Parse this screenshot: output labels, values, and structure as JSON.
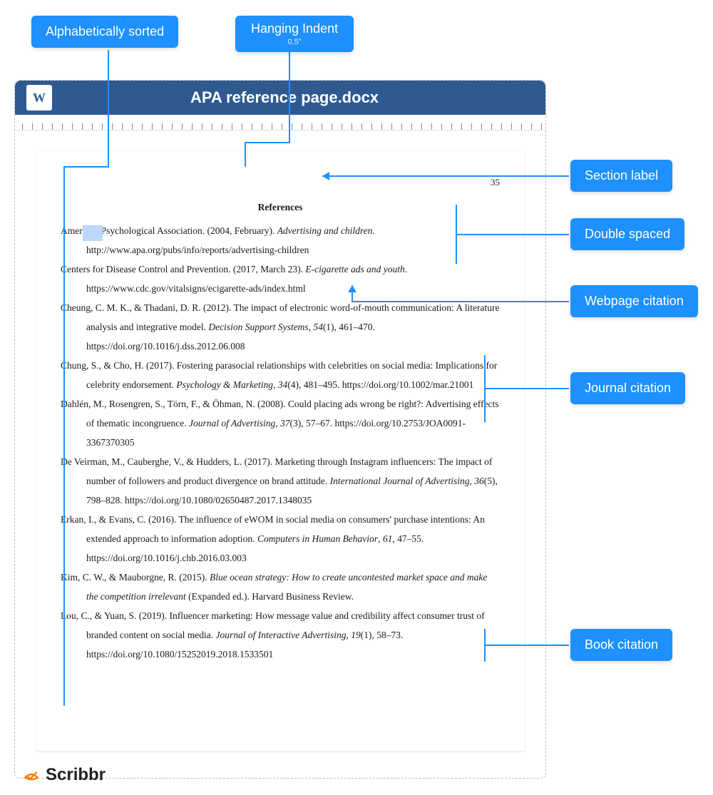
{
  "tags": {
    "alpha_sorted": "Alphabetically sorted",
    "hanging_indent": "Hanging Indent",
    "hanging_indent_sub": "0.5\"",
    "section_label": "Section label",
    "double_spaced": "Double spaced",
    "webpage_citation": "Webpage citation",
    "journal_citation": "Journal citation",
    "book_citation": "Book citation"
  },
  "doc": {
    "title": "APA reference page.docx",
    "page_num": "35",
    "heading": "References"
  },
  "refs": [
    {
      "author": "American Psychological Association. (2004, February). ",
      "italic": "Advertising and children",
      "post": ". http://www.apa.org/pubs/info/reports/advertising-children"
    },
    {
      "author": "Centers for Disease Control and Prevention. (2017, March 23). ",
      "italic": "E-cigarette ads and youth",
      "post": ". https://www.cdc.gov/vitalsigns/ecigarette-ads/index.html"
    },
    {
      "author": "Cheung, C. M. K., & Thadani, D. R. (2012). The impact of electronic word-of-mouth communication: A literature analysis and integrative model. ",
      "italic": "Decision Support Systems",
      "post": ", ",
      "italic2": "54",
      "post2": "(1), 461–470. https://doi.org/10.1016/j.dss.2012.06.008"
    },
    {
      "author": "Chung, S., & Cho, H. (2017). Fostering parasocial relationships with celebrities on social media: Implications for celebrity endorsement. ",
      "italic": "Psychology & Marketing",
      "post": ", ",
      "italic2": "34",
      "post2": "(4), 481–495. https://doi.org/10.1002/mar.21001"
    },
    {
      "author": "Dahlén, M., Rosengren, S., Törn, F., & Öhman, N. (2008). Could placing ads wrong be right?: Advertising effects of thematic incongruence. ",
      "italic": "Journal of Advertising",
      "post": ", ",
      "italic2": "37",
      "post2": "(3), 57–67. https://doi.org/10.2753/JOA0091-3367370305"
    },
    {
      "author": "De Veirman, M., Cauberghe, V., & Hudders, L. (2017). Marketing through Instagram influencers: The impact of number of followers and product divergence on brand attitude. ",
      "italic": "International Journal of Advertising",
      "post": ", ",
      "italic2": "36",
      "post2": "(5), 798–828. https://doi.org/10.1080/02650487.2017.1348035"
    },
    {
      "author": "Erkan, I., & Evans, C. (2016). The influence of eWOM in social media on consumers' purchase intentions: An extended approach to information adoption. ",
      "italic": "Computers in Human Behavior",
      "post": ", ",
      "italic2": "61",
      "post2": ", 47–55. https://doi.org/10.1016/j.chb.2016.03.003"
    },
    {
      "author": "Kim, C. W., & Mauborgne, R. (2015). ",
      "italic": "Blue ocean strategy: How to create uncontested market space and make the competition irrelevant",
      "post": " (Expanded ed.). Harvard Business Review."
    },
    {
      "author": "Lou, C., & Yuan, S. (2019). Influencer marketing: How message value and credibility affect consumer trust of branded content on social media. ",
      "italic": "Journal of Interactive Advertising",
      "post": ", ",
      "italic2": "19",
      "post2": "(1), 58–73. https://doi.org/10.1080/15252019.2018.1533501"
    }
  ],
  "logo": {
    "text": "Scribbr"
  }
}
